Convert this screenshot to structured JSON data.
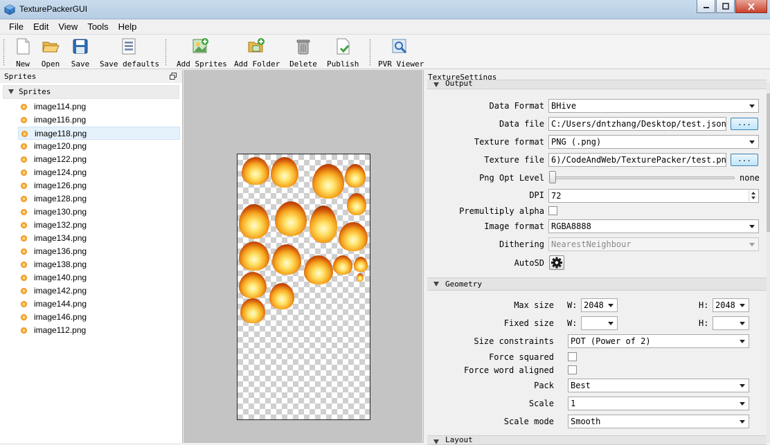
{
  "window": {
    "title": "TexturePackerGUI",
    "minimize_icon": "minimize-icon",
    "maximize_icon": "maximize-icon",
    "close_icon": "close-icon"
  },
  "menu": [
    "File",
    "Edit",
    "View",
    "Tools",
    "Help"
  ],
  "toolbar": {
    "new": "New",
    "open": "Open",
    "save": "Save",
    "save_defaults": "Save defaults",
    "add_sprites": "Add Sprites",
    "add_folder": "Add Folder",
    "delete": "Delete",
    "publish": "Publish",
    "pvr_viewer": "PVR Viewer"
  },
  "sprites_panel": {
    "title": "Sprites",
    "root": "Sprites",
    "selected_index": 2,
    "items": [
      "image114.png",
      "image116.png",
      "image118.png",
      "image120.png",
      "image122.png",
      "image124.png",
      "image126.png",
      "image128.png",
      "image130.png",
      "image132.png",
      "image134.png",
      "image136.png",
      "image138.png",
      "image140.png",
      "image142.png",
      "image144.png",
      "image146.png",
      "image112.png"
    ]
  },
  "settings_panel": {
    "title": "TextureSettings",
    "output": {
      "header": "Output",
      "data_format_label": "Data Format",
      "data_format_value": "BHive",
      "data_file_label": "Data file",
      "data_file_value": "C:/Users/dntzhang/Desktop/test.json",
      "browse": "...",
      "texture_format_label": "Texture format",
      "texture_format_value": "PNG (.png)",
      "texture_file_label": "Texture file",
      "texture_file_value": "6)/CodeAndWeb/TexturePacker/test.png",
      "png_opt_label": "Png Opt Level",
      "png_opt_value": "none",
      "png_opt_level": 0,
      "dpi_label": "DPI",
      "dpi_value": "72",
      "premultiply_label": "Premultiply alpha",
      "premultiply_checked": false,
      "image_format_label": "Image format",
      "image_format_value": "RGBA8888",
      "dithering_label": "Dithering",
      "dithering_value": "NearestNeighbour",
      "autosd_label": "AutoSD",
      "autosd_icon": "gear-icon"
    },
    "geometry": {
      "header": "Geometry",
      "max_size_label": "Max size",
      "w_label": "W:",
      "h_label": "H:",
      "max_w": "2048",
      "max_h": "2048",
      "fixed_size_label": "Fixed size",
      "fixed_w": "",
      "fixed_h": "",
      "size_constraints_label": "Size constraints",
      "size_constraints_value": "POT (Power of 2)",
      "force_squared_label": "Force squared",
      "force_squared_checked": false,
      "force_word_label": "Force word aligned",
      "force_word_checked": false,
      "pack_label": "Pack",
      "pack_value": "Best",
      "scale_label": "Scale",
      "scale_value": "1",
      "scale_mode_label": "Scale mode",
      "scale_mode_value": "Smooth"
    },
    "layout": {
      "header": "Layout"
    }
  },
  "colors": {
    "titlebar": "#c9dcee",
    "selection": "#e5f1fb",
    "canvas_bg": "#c4c4c4",
    "browse_button": "#bee6fd"
  }
}
